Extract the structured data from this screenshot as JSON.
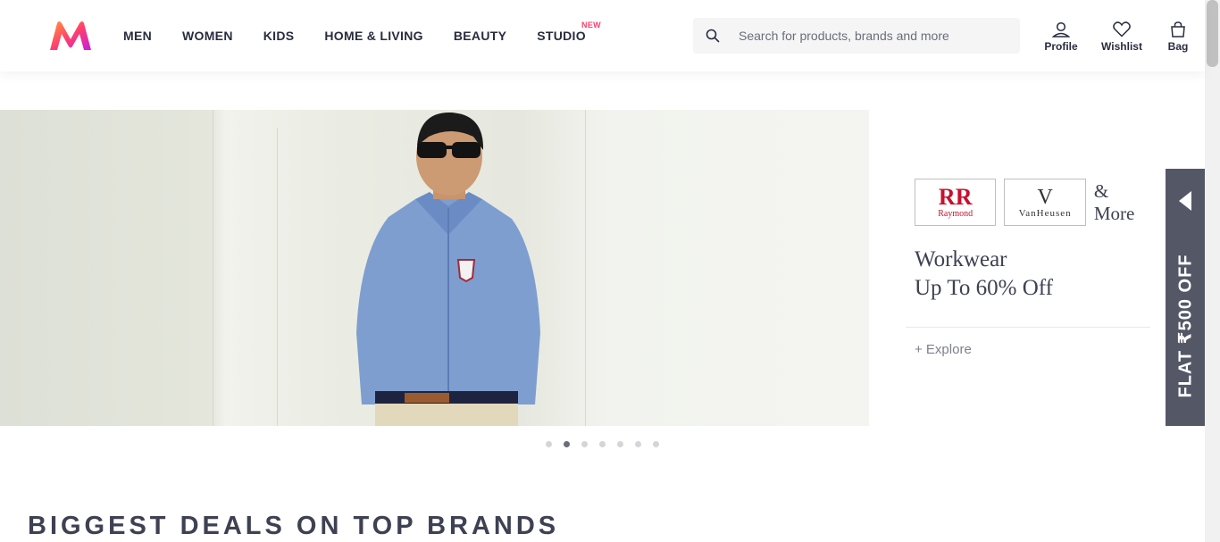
{
  "header": {
    "nav": [
      {
        "label": "MEN"
      },
      {
        "label": "WOMEN"
      },
      {
        "label": "KIDS"
      },
      {
        "label": "HOME & LIVING"
      },
      {
        "label": "BEAUTY"
      },
      {
        "label": "STUDIO",
        "badge": "NEW"
      }
    ],
    "search": {
      "placeholder": "Search for products, brands and more",
      "icon": "search-icon"
    },
    "actions": [
      {
        "label": "Profile",
        "icon": "profile-icon"
      },
      {
        "label": "Wishlist",
        "icon": "heart-icon"
      },
      {
        "label": "Bag",
        "icon": "bag-icon"
      }
    ]
  },
  "promo": {
    "brands": [
      {
        "name": "Raymond",
        "logo_text": "RR"
      },
      {
        "name": "VanHeusen",
        "logo_text": "V"
      }
    ],
    "and_more": "& More",
    "title_line1": "Workwear",
    "title_line2": "Up To 60% Off",
    "explore": "+ Explore"
  },
  "flat_tab": {
    "text": "FLAT ₹500 OFF"
  },
  "carousel": {
    "total": 7,
    "active_index": 1
  },
  "section": {
    "title": "BIGGEST DEALS ON TOP BRANDS"
  },
  "colors": {
    "brand_pink": "#ff3f6c",
    "text_dark": "#282c3f",
    "tab_gray": "#535766"
  }
}
